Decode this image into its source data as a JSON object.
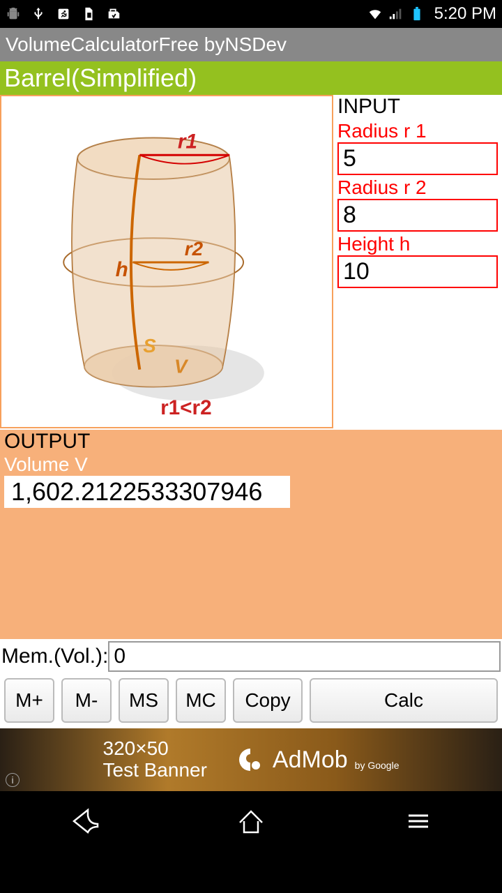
{
  "status": {
    "time": "5:20 PM",
    "icons": [
      "android-icon",
      "usb-icon",
      "running-icon",
      "sim-icon",
      "storage-icon"
    ]
  },
  "app": {
    "title": "VolumeCalculatorFree byNSDev",
    "shape_title": "Barrel(Simplified)"
  },
  "diagram": {
    "r1": "r1",
    "r2": "r2",
    "h": "h",
    "s": "S",
    "v": "V",
    "constraint": "r1<r2"
  },
  "inputs": {
    "header": "INPUT",
    "fields": [
      {
        "label": "Radius  r 1",
        "value": "5"
      },
      {
        "label": "Radius  r 2",
        "value": "8"
      },
      {
        "label": "Height h",
        "value": "10"
      }
    ]
  },
  "output": {
    "header": "OUTPUT",
    "label": "Volume V",
    "value": "1,602.2122533307946"
  },
  "memory": {
    "label": "Mem.(Vol.):",
    "value": "0"
  },
  "buttons": {
    "m_plus": "M+",
    "m_minus": "M-",
    "ms": "MS",
    "mc": "MC",
    "copy": "Copy",
    "calc": "Calc"
  },
  "ad": {
    "line1": "320×50",
    "line2": "Test Banner",
    "brand": "AdMob",
    "by": "by Google"
  }
}
